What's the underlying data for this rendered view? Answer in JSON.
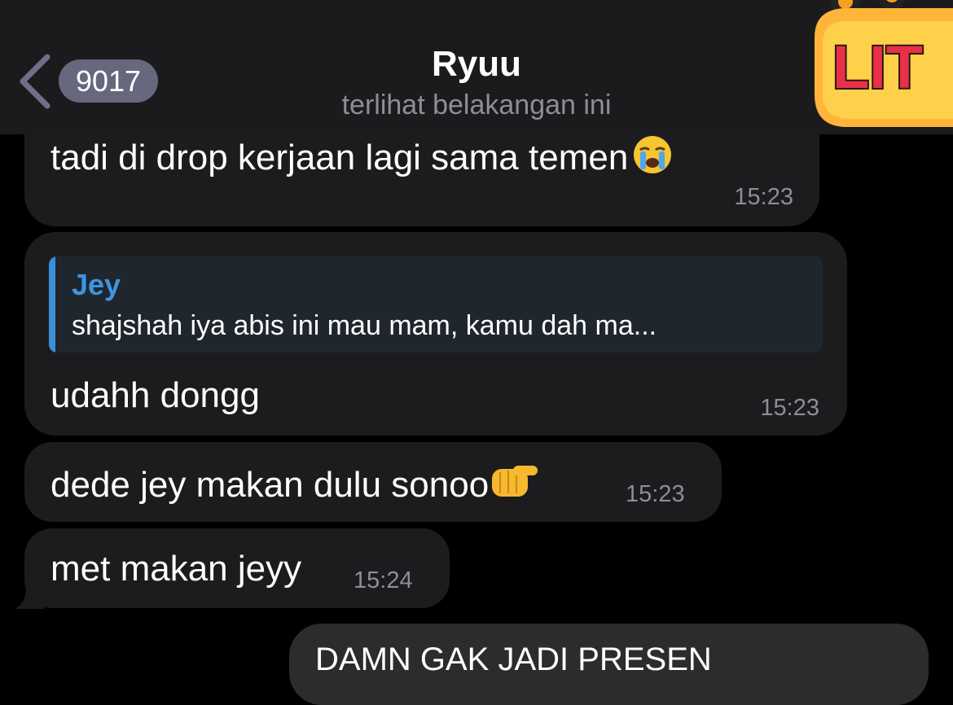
{
  "header": {
    "back_count": "9017",
    "title": "Ryuu",
    "status": "terlihat belakangan ini",
    "avatar_text": "LIT"
  },
  "messages": [
    {
      "text": "tadi di drop kerjaan lagi sama temen",
      "emoji": "crying-face",
      "time": "15:23"
    },
    {
      "reply_name": "Jey",
      "reply_text": "shajshah iya abis ini mau mam, kamu dah ma...",
      "text": "udahh dongg",
      "time": "15:23"
    },
    {
      "text": "dede jey makan dulu sonoo",
      "emoji": "pointing-hand",
      "time": "15:23"
    },
    {
      "text": "met makan jeyy",
      "time": "15:24"
    },
    {
      "text": "DAMN GAK JADI PRESEN",
      "outgoing": true
    }
  ],
  "colors": {
    "background": "#000000",
    "bubble": "#1c1c1e",
    "accent": "#3d95e0",
    "muted": "#8e8e93"
  }
}
